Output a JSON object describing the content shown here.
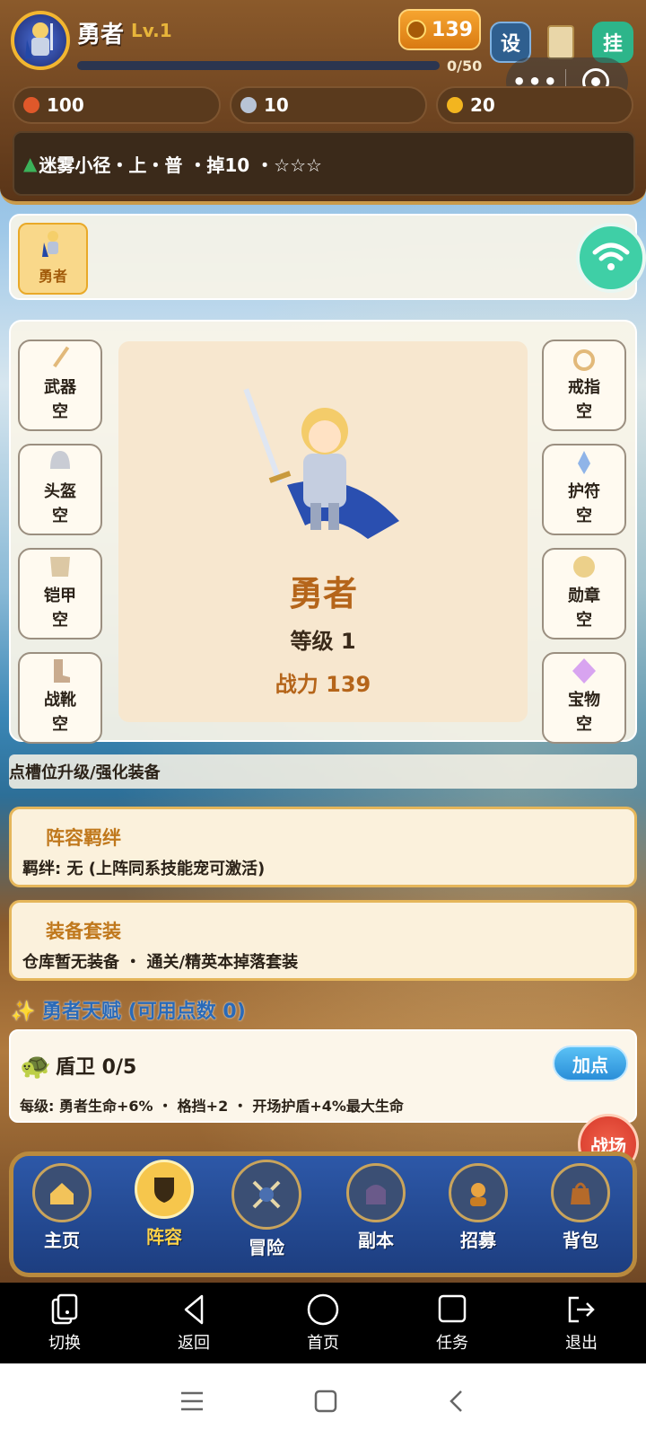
{
  "header": {
    "hero_name": "勇者",
    "hero_level": "Lv.1",
    "xp_text": "0/50",
    "xp_progress": 0,
    "power_value": "139",
    "settings_label": "设",
    "hang_label": "挂"
  },
  "resources": [
    {
      "value": "100",
      "color": "#e0582a"
    },
    {
      "value": "10",
      "color": "#b8c4d6"
    },
    {
      "value": "20",
      "color": "#f3b51f"
    }
  ],
  "stage": {
    "text": "迷雾小径・上・普 ・掉10 ・☆☆☆"
  },
  "hero_tab": {
    "label": "勇者"
  },
  "equipment": {
    "left": [
      {
        "name": "武器",
        "status": "空"
      },
      {
        "name": "头盔",
        "status": "空"
      },
      {
        "name": "铠甲",
        "status": "空"
      },
      {
        "name": "战靴",
        "status": "空"
      }
    ],
    "right": [
      {
        "name": "戒指",
        "status": "空"
      },
      {
        "name": "护符",
        "status": "空"
      },
      {
        "name": "勋章",
        "status": "空"
      },
      {
        "name": "宝物",
        "status": "空"
      }
    ],
    "hero_name": "勇者",
    "level_text": "等级 1",
    "power_text": "战力 139"
  },
  "hint": "点槽位升级/强化装备",
  "bond": {
    "title": "阵容羁绊",
    "body": "羁绊: 无 (上阵同系技能宠可激活)"
  },
  "suit": {
    "title": "装备套装",
    "body": "仓库暂无装备 ・ 通关/精英本掉落套装"
  },
  "talent": {
    "heading": "✨ 勇者天赋 (可用点数 0)",
    "name": "盾卫 0/5",
    "desc": "每级: 勇者生命+6% ・ 格挡+2 ・ 开场护盾+4%最大生命",
    "add_label": "加点"
  },
  "battle_label": "战场",
  "game_nav": [
    {
      "label": "主页",
      "icon": "home-icon"
    },
    {
      "label": "阵容",
      "icon": "lineup-icon",
      "active": true
    },
    {
      "label": "冒险",
      "icon": "adventure-icon"
    },
    {
      "label": "副本",
      "icon": "dungeon-icon"
    },
    {
      "label": "招募",
      "icon": "recruit-icon"
    },
    {
      "label": "背包",
      "icon": "bag-icon"
    }
  ],
  "system_bar": [
    {
      "label": "切换",
      "icon": "switch-icon"
    },
    {
      "label": "返回",
      "icon": "back-icon"
    },
    {
      "label": "首页",
      "icon": "home-circle-icon"
    },
    {
      "label": "任务",
      "icon": "task-icon"
    },
    {
      "label": "退出",
      "icon": "exit-icon"
    }
  ]
}
